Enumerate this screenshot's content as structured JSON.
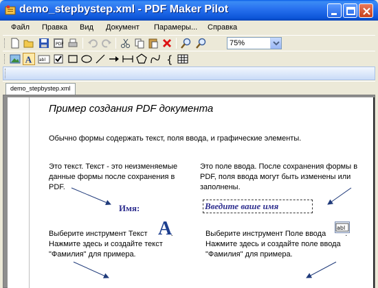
{
  "window": {
    "title": "demo_stepbystep.xml - PDF Maker Pilot"
  },
  "menu": {
    "items": [
      "Файл",
      "Правка",
      "Вид",
      "Документ",
      "Парамеры...",
      "Справка"
    ]
  },
  "toolbar": {
    "zoom_value": "75%",
    "standard_icons": [
      "new-icon",
      "open-icon",
      "save-icon",
      "pdf-icon",
      "print-icon",
      "undo-icon",
      "redo-icon",
      "cut-icon",
      "copy-icon",
      "paste-icon",
      "delete-icon",
      "zoom-in-icon",
      "zoom-out-icon"
    ],
    "tool_icons": [
      "image-tool-icon",
      "text-tool-icon",
      "input-field-tool-icon",
      "checkbox-tool-icon",
      "rectangle-tool-icon",
      "ellipse-tool-icon",
      "line-tool-icon",
      "arrow-tool-icon",
      "dimension-tool-icon",
      "polygon-tool-icon",
      "curve-tool-icon",
      "brace-tool-icon",
      "table-tool-icon"
    ]
  },
  "tabs": {
    "document": "demo_stepbystep.xml"
  },
  "document": {
    "heading": "Пример создания PDF документа",
    "intro": "Обычно формы содержать текст, поля ввода, и графические элементы.",
    "left_text": "Это текст. Текст - это неизменяемые данные формы после сохранения в PDF.",
    "right_text": "Это поле ввода. После сохранения формы в PDF,  поля ввода могут быть изменены или заполнены.",
    "name_label": "Имя:",
    "input_placeholder": "Введите ваше имя",
    "left_instruction_1": "Выберите инструмент Текст",
    "left_instruction_2": ". Нажмите здесь и создайте текст \"Фамилия\" для примера.",
    "right_instruction_1": "Выберите инструмент Поле ввода",
    "right_instruction_2": ". Нажмите здесь и создайте поле ввода \"Фамилия\" для примера.",
    "big_a": "A",
    "field_icon_text": "abl"
  }
}
